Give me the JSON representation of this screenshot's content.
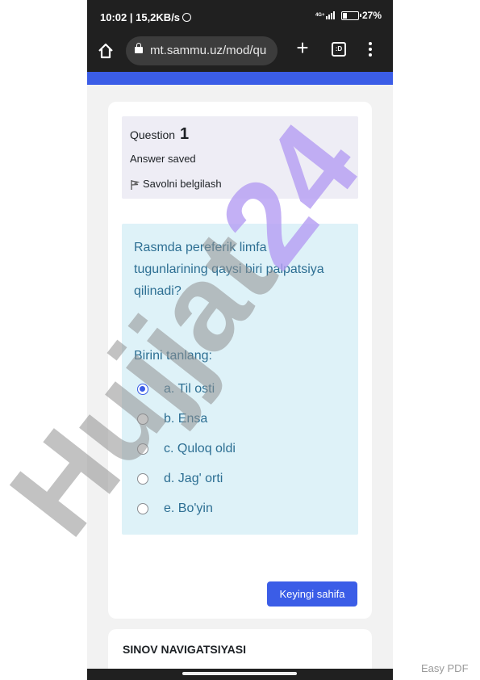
{
  "status_bar": {
    "time": "10:02 | 15,2KB/s",
    "network_label": "4G+",
    "battery_percent": "27%",
    "battery_level": 0.27
  },
  "browser": {
    "url": "mt.sammu.uz/mod/qu",
    "tab_count_label": ":D"
  },
  "colors": {
    "accent": "#3b5de7",
    "question_bg": "#def2f8",
    "info_bg": "#eeedf5",
    "question_text": "#2d6f93"
  },
  "question_info": {
    "label": "Question",
    "number": "1",
    "state": "Answer saved",
    "flag_label": "Savolni belgilash",
    "flag_icon": "flag-icon"
  },
  "question": {
    "text": "Rasmda pereferik limfa tugunlarining qaysi biri palpatsiya qilinadi?",
    "prompt": "Birini tanlang:",
    "selected_index": 0,
    "answers": [
      {
        "letter": "a.",
        "text": "Til osti"
      },
      {
        "letter": "b.",
        "text": "Ensa"
      },
      {
        "letter": "c.",
        "text": "Quloq oldi"
      },
      {
        "letter": "d.",
        "text": "Jag' orti"
      },
      {
        "letter": "e.",
        "text": "Bo'yin"
      }
    ],
    "answer_labels": [
      "a. Til osti",
      "b. Ensa",
      "c. Quloq oldi",
      "d. Jag' orti",
      "e. Bo'yin"
    ]
  },
  "navigation": {
    "next_label": "Keyingi sahifa",
    "quiz_nav_title": "SINOV NAVIGATSIYASI"
  },
  "watermark": {
    "text": "Hujjat24",
    "footer": "Easy PDF"
  }
}
